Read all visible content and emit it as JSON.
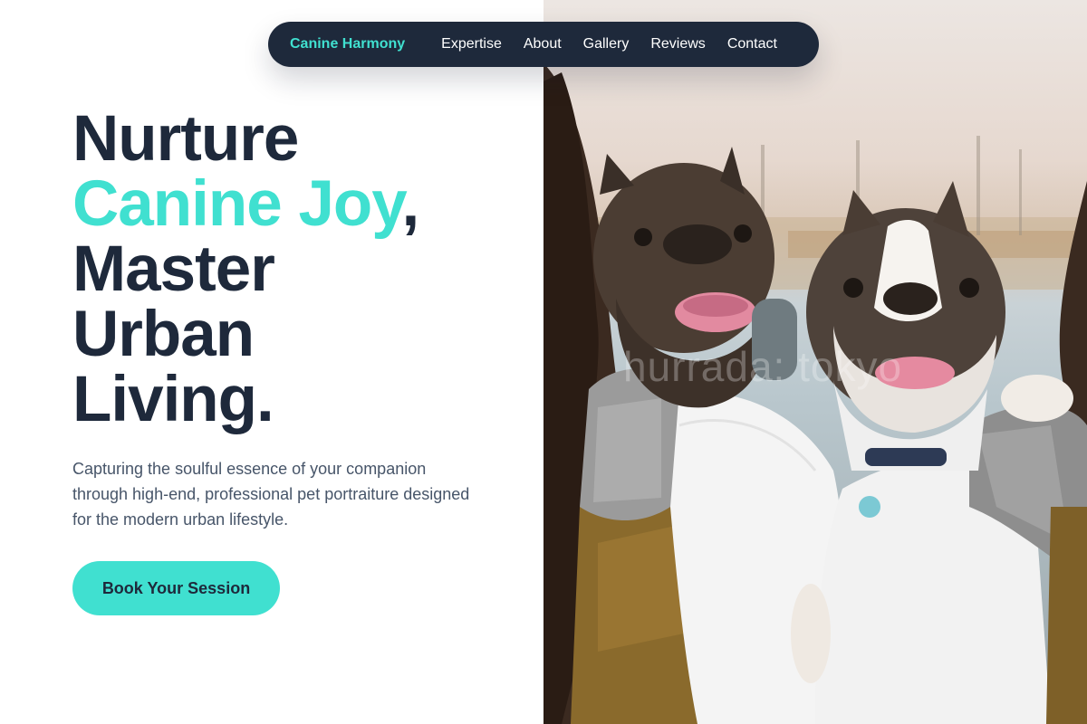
{
  "nav": {
    "brand": "Canine Harmony",
    "links": [
      "Expertise",
      "About",
      "Gallery",
      "Reviews",
      "Contact"
    ]
  },
  "hero": {
    "headline": {
      "line1": "Nurture",
      "accent": "Canine Joy",
      "comma": ",",
      "line3": "Master",
      "line4": "Urban",
      "line5": "Living."
    },
    "subtitle": "Capturing the soulful essence of your companion through high-end, professional pet portraiture designed for the modern urban lifestyle.",
    "cta_label": "Book Your Session",
    "photo": {
      "watermark": "hurrada: tokyo"
    }
  },
  "colors": {
    "accent": "#40e0d0",
    "dark": "#1e293b",
    "body_text": "#475569",
    "background": "#ffffff"
  }
}
